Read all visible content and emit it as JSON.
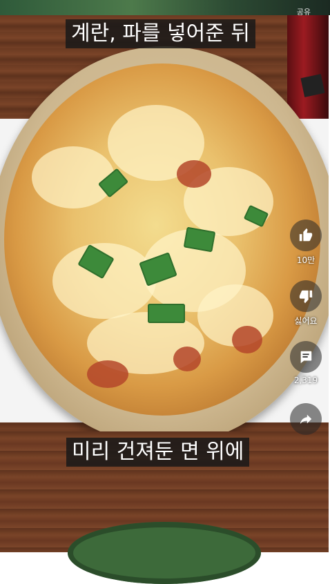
{
  "top_share_label": "공유",
  "captions": {
    "first": "계란, 파를 넣어준 뒤",
    "second": "미리 건져둔 면 위에"
  },
  "actions": {
    "like_count": "10만",
    "dislike_label": "싫어요",
    "comment_count": "2,319"
  },
  "icons": {
    "like": "thumbs-up-icon",
    "dislike": "thumbs-down-icon",
    "comment": "comment-icon",
    "share": "share-arrow-icon"
  },
  "colors": {
    "caption_bg": "#191919",
    "caption_text": "#ffffff",
    "action_circle": "#282828"
  }
}
